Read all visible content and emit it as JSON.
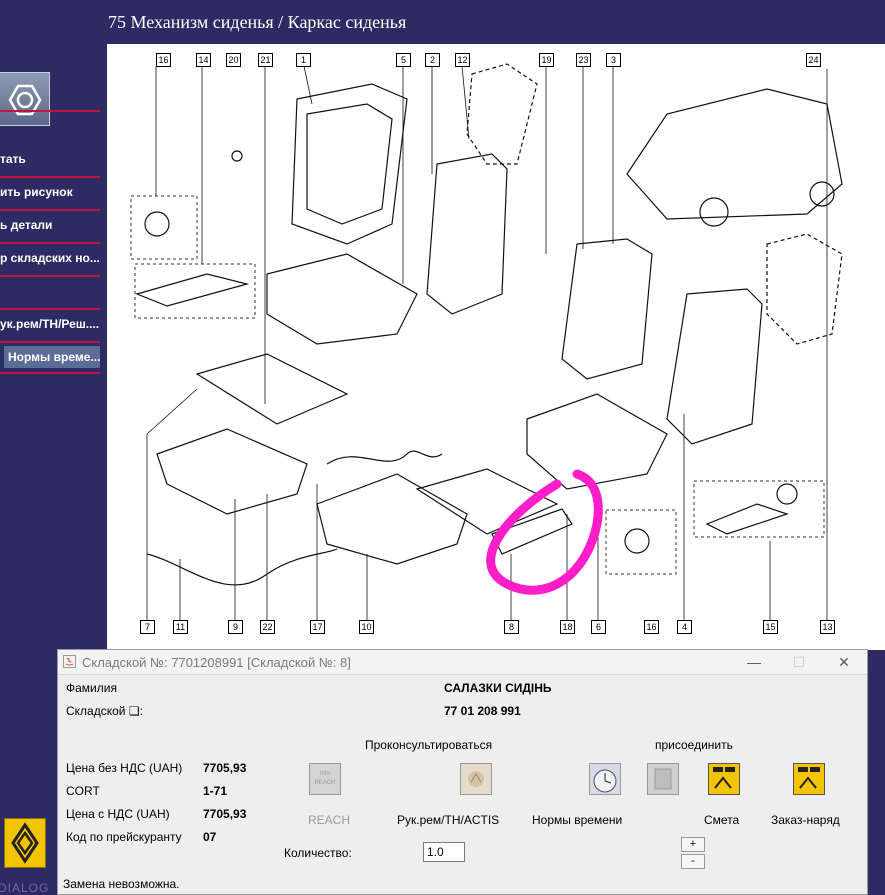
{
  "page_title": "75 Механизм сиденья / Каркас сиденья",
  "sidebar": {
    "items": [
      {
        "label": "тать"
      },
      {
        "label": "ить рисунок"
      },
      {
        "label": "ь детали"
      },
      {
        "label": "р складских но..."
      },
      {
        "label": "ук.рем/TH/Реш...."
      },
      {
        "label": "Нормы време..."
      }
    ],
    "watermark": "DIALOG"
  },
  "diagram": {
    "callouts_top": [
      "16",
      "14",
      "20",
      "21",
      "1",
      "5",
      "2",
      "12",
      "19",
      "23",
      "3",
      "24"
    ],
    "callouts_bottom": [
      "7",
      "11",
      "9",
      "22",
      "17",
      "10",
      "8",
      "18",
      "6",
      "16",
      "4",
      "15",
      "13"
    ],
    "highlight_color": "#ff1ec8"
  },
  "dialog": {
    "title": "Складской №: 7701208991 [Складской №: 8]",
    "family_label": "Фамилия",
    "family_value": "САЛАЗКИ СИДІНЬ",
    "stock_label": "Складской ❏:",
    "stock_value": "77 01 208 991",
    "consult_label": "Проконсультироваться",
    "attach_label": "присоединить",
    "price_no_vat_label": "Цена без НДС (UAH)",
    "price_no_vat_value": "7705,93",
    "cort_label": "CORT",
    "cort_value": "1-71",
    "price_vat_label": "Цена с НДС (UAH)",
    "price_vat_value": "7705,93",
    "price_code_label": "Код по прейскуранту",
    "price_code_value": "07",
    "reach_icon_text": "Info REACH",
    "buttons": {
      "reach": "REACH",
      "repair": "Рук.рем/TH/ACTIS",
      "norms": "Нормы времени",
      "estimate": "Смета",
      "order": "Заказ-наряд"
    },
    "quantity_label": "Количество:",
    "quantity_value": "1.0",
    "plus": "+",
    "minus": "-",
    "status": "Замена невозможна."
  }
}
